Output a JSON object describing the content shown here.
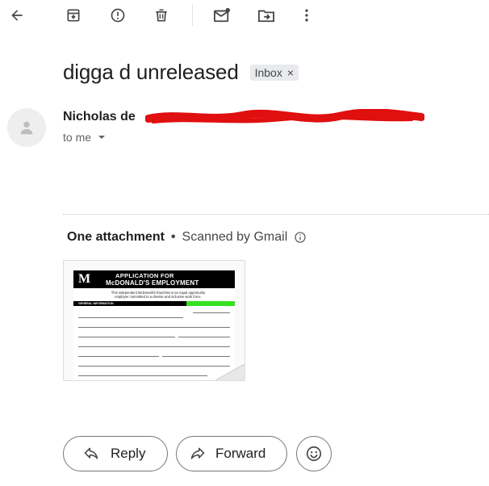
{
  "toolbar": {
    "items": [
      "back",
      "archive",
      "report-spam",
      "delete",
      "mark-unread",
      "move-to",
      "more"
    ]
  },
  "email": {
    "subject": "digga d unreleased",
    "label_chip": "Inbox",
    "label_remove": "×",
    "sender_name": "Nicholas de",
    "recipient": "to me"
  },
  "attachments": {
    "title": "One attachment",
    "separator": "•",
    "scan_note": "Scanned by Gmail",
    "file_preview": {
      "logo": "M",
      "heading_line1": "APPLICATION FOR",
      "heading_line2": "McDONALD'S EMPLOYMENT",
      "notice": "This independent McDonald's franchise is an equal opportunity employer committed to a diverse and inclusive work force.",
      "section": "GENERAL INFORMATION"
    }
  },
  "actions": {
    "reply_label": "Reply",
    "forward_label": "Forward"
  }
}
